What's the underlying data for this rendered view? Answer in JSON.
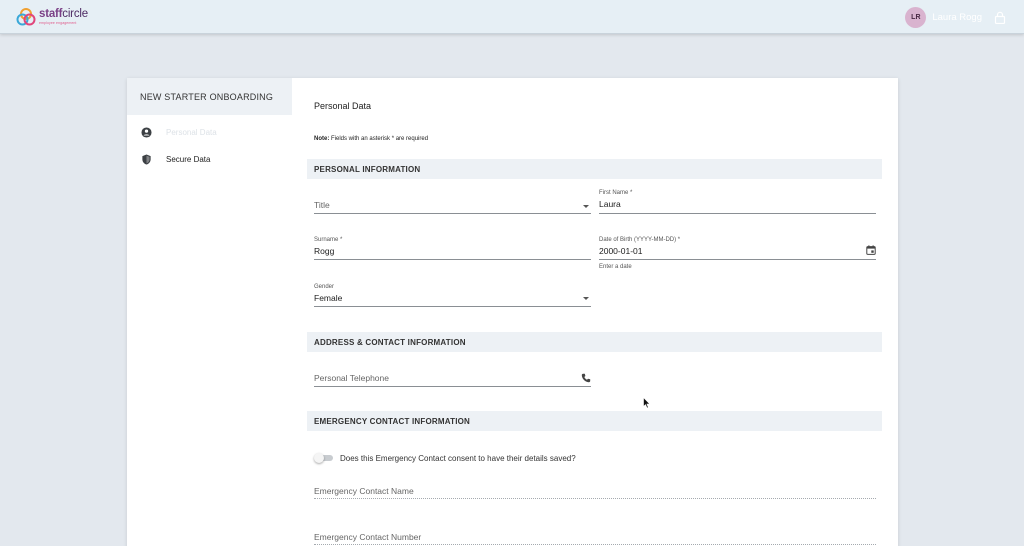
{
  "topbar": {
    "logo": {
      "word_bold": "staff",
      "word_light": "circle",
      "tagline": "employee engagement",
      "icon": "staffcircle-logo-icon"
    },
    "user": {
      "initials": "LR",
      "name": "Laura Rogg"
    },
    "lock_icon": "lock-icon"
  },
  "sidebar": {
    "header": "NEW STARTER ONBOARDING",
    "items": [
      {
        "label": "Personal Data",
        "icon": "account-circle-icon",
        "active": true
      },
      {
        "label": "Secure Data",
        "icon": "shield-icon",
        "active": false
      }
    ]
  },
  "main": {
    "page_title": "Personal Data",
    "note_prefix": "Note:",
    "note_text": " Fields with an asterisk * are required",
    "sections": {
      "personal": {
        "heading": "PERSONAL INFORMATION",
        "title": {
          "placeholder": "Title"
        },
        "first_name": {
          "label": "First Name *",
          "value": "Laura"
        },
        "surname": {
          "label": "Surname *",
          "value": "Rogg"
        },
        "dob": {
          "label": "Date of Birth (YYYY-MM-DD) *",
          "value": "2000-01-01",
          "helper": "Enter a date"
        },
        "gender": {
          "label": "Gender",
          "value": "Female"
        }
      },
      "address": {
        "heading": "ADDRESS & CONTACT INFORMATION",
        "telephone": {
          "placeholder": "Personal Telephone"
        }
      },
      "emergency": {
        "heading": "EMERGENCY CONTACT INFORMATION",
        "consent_label": "Does this Emergency Contact consent to have their details saved?",
        "consent_on": false,
        "contact_name": {
          "placeholder": "Emergency Contact Name"
        },
        "contact_number": {
          "placeholder": "Emergency Contact Number"
        }
      }
    }
  },
  "colors": {
    "topbar_bg": "#e6eff5",
    "page_bg": "#e3e8ee",
    "section_bg": "#edf1f5",
    "brand_purple": "#7a3f86",
    "avatar_bg": "#d9b3cf"
  }
}
